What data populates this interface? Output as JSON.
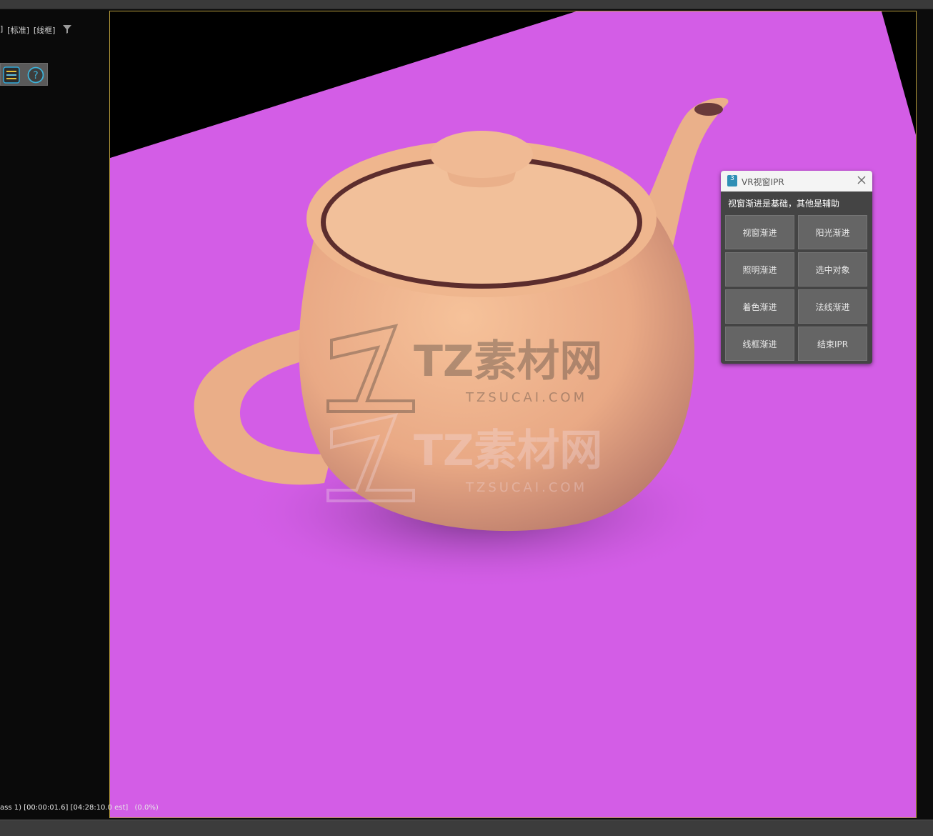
{
  "viewport_labels": [
    "]",
    "[标准]",
    "[线框]"
  ],
  "toolbar": {
    "list_icon": "list-icon",
    "help_icon": "help-icon"
  },
  "status": {
    "render_info": "ass 1) [00:00:01.6] [04:28:10.0 est]",
    "progress": "(0.0%)"
  },
  "watermark": {
    "brand": "TZ素材网",
    "domain": "TZSUCAI.COM"
  },
  "ipr": {
    "title": "VR视窗IPR",
    "subtitle": "视窗渐进是基础，其他是辅助",
    "buttons": [
      "视窗渐进",
      "阳光渐进",
      "照明渐进",
      "选中对象",
      "着色渐进",
      "法线渐进",
      "线框渐进",
      "结束IPR"
    ]
  },
  "colors": {
    "floor": "#d35de6",
    "teapot": "#f0b48a",
    "viewport_border": "#b59a3a"
  }
}
